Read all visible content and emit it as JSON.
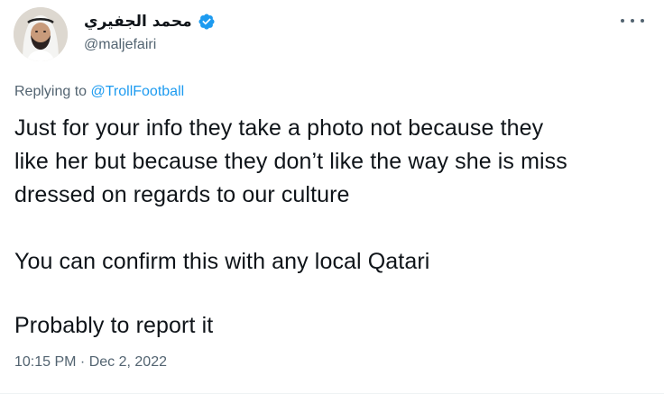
{
  "tweet": {
    "author": {
      "display_name": "محمد الجفيري",
      "handle": "@maljefairi",
      "verified_icon": "verified-badge-icon"
    },
    "more_icon": "more-dots-icon",
    "reply": {
      "prefix": "Replying to ",
      "to_handle": "@TrollFootball"
    },
    "text": {
      "paragraph_1": "Just for your info they take a photo not because they\nlike her but because they don’t like the way she is miss\ndressed on regards to our culture",
      "paragraph_2": "You can confirm this with any local Qatari",
      "paragraph_3": "Probably to report it"
    },
    "time": "10:15 PM",
    "separator": " · ",
    "date": "Dec 2, 2022"
  },
  "colors": {
    "link": "#1d9bf0",
    "secondary_text": "#536471",
    "primary_text": "#0f1419"
  }
}
